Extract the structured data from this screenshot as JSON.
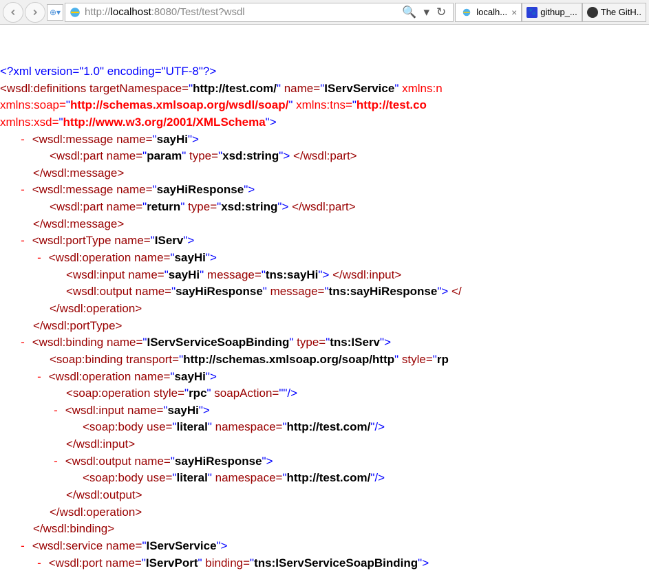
{
  "toolbar": {
    "url_gray1": "http://",
    "url_black": "localhost",
    "url_gray2": ":8080/Test/test?wsdl",
    "search_symbol": "🔍",
    "dropdown_symbol": "▾",
    "refresh_symbol": "↻"
  },
  "tabs": [
    {
      "label": "localh...",
      "active": true,
      "close": "×",
      "icon": "ie"
    },
    {
      "label": "githup_...",
      "active": false,
      "icon": "paw"
    },
    {
      "label": "The GitH..",
      "active": false,
      "icon": "github"
    }
  ],
  "xml": {
    "decl": "<?xml version=\"1.0\" encoding=\"UTF-8\"?>",
    "defOpen1": "<wsdl:definitions",
    "attrTargetNs": " targetNamespace=",
    "valTargetNs": "\"http://test.com/\"",
    "attrName": " name=",
    "valName": "\"IServService\"",
    "attrXmlnsNs": " xmlns:n",
    "line2a": "xmlns:soap=",
    "line2b": "\"http://schemas.xmlsoap.org/wsdl/soap/\"",
    "line2c": " xmlns:tns=",
    "line2d": "\"http://test.co",
    "line3a": "xmlns:xsd=",
    "line3b": "\"http://www.w3.org/2001/XMLSchema\"",
    "gt": ">",
    "msg1Open": "<wsdl:message",
    "msg1NameAttr": " name=",
    "msg1NameVal": "\"sayHi\"",
    "partOpen": "<wsdl:part",
    "partNameAttr": " name=",
    "partNameVal1": "\"param\"",
    "partTypeAttr": " type=",
    "partTypeVal": "\"xsd:string\"",
    "partClose": "</wsdl:part>",
    "msgClose": "</wsdl:message>",
    "msg2NameVal": "\"sayHiResponse\"",
    "partNameVal2": "\"return\"",
    "ptOpen": "<wsdl:portType",
    "ptNameVal": "\"IServ\"",
    "opOpen": "<wsdl:operation",
    "opNameVal": "\"sayHi\"",
    "inOpen": "<wsdl:input",
    "inNameVal": "\"sayHi\"",
    "msgAttr": " message=",
    "inMsgVal": "\"tns:sayHi\"",
    "inClose": "</wsdl:input>",
    "outOpen": "<wsdl:output",
    "outNameVal": "\"sayHiResponse\"",
    "outMsgVal": "\"tns:sayHiResponse\"",
    "outCloseFrag": "> </",
    "opClose": "</wsdl:operation>",
    "ptClose": "</wsdl:portType>",
    "bindOpen": "<wsdl:binding",
    "bindNameVal": "\"IServServiceSoapBinding\"",
    "bindTypeAttr": " type=",
    "bindTypeVal": "\"tns:IServ\"",
    "soapBindOpen": "<soap:binding",
    "transAttr": " transport=",
    "transVal": "\"http://schemas.xmlsoap.org/soap/http\"",
    "styleAttr": " style=",
    "styleValFrag": "\"rp",
    "soapOpOpen": "<soap:operation",
    "soapOpStyleVal": "\"rpc\"",
    "soapActionAttr": " soapAction=",
    "soapActionVal": "\"\"",
    "selfClose": "/>",
    "soapBodyOpen": "<soap:body",
    "useAttr": " use=",
    "useVal": "\"literal\"",
    "nsAttr": " namespace=",
    "nsVal": "\"http://test.com/\"",
    "inCloseTag": "</wsdl:input>",
    "outCloseTag": "</wsdl:output>",
    "bindClose": "</wsdl:binding>",
    "svcOpen": "<wsdl:service",
    "svcNameVal": "\"IServService\"",
    "portOpen": "<wsdl:port",
    "portNameVal": "\"IServPort\"",
    "bindingAttr": " binding=",
    "portBindVal": "\"tns:IServServiceSoapBinding\"",
    "dash": "-"
  }
}
